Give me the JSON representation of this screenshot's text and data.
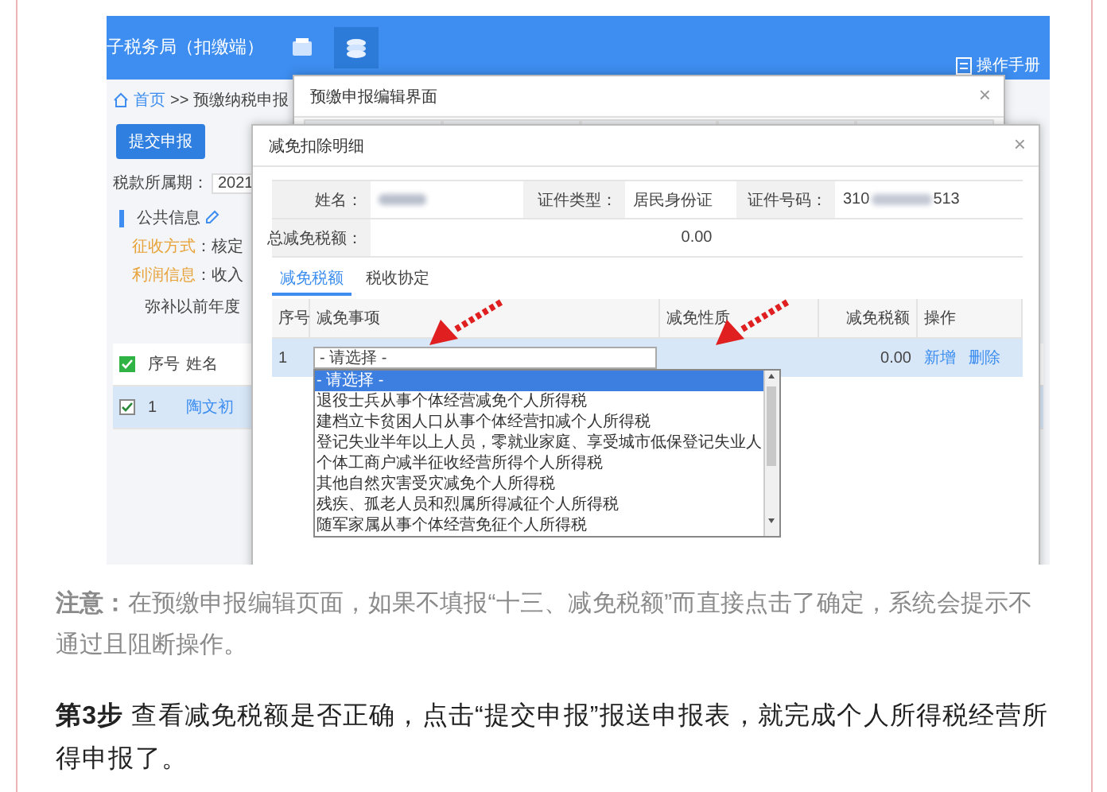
{
  "app": {
    "title": "子税务局（扣缴端）",
    "nav": [
      {
        "selected": false
      },
      {
        "selected": true
      }
    ],
    "manual_link": "操作手册",
    "breadcrumb": {
      "home": "首页",
      "separator": ">>",
      "current": "预缴纳税申报"
    },
    "submit_button": "提交申报",
    "period": {
      "label": "税款所属期：",
      "value": "2021"
    },
    "section_title": "公共信息",
    "fields": [
      {
        "label": "征收方式",
        "value": "：核定"
      },
      {
        "label": "利润信息",
        "value": "：收入"
      }
    ],
    "loss_note": "弥补以前年度",
    "table": {
      "header_checked": true,
      "columns": [
        "序号",
        "姓名"
      ],
      "rows": [
        {
          "checked": true,
          "selected": true,
          "index": "1",
          "name": "陶文初"
        }
      ]
    }
  },
  "edit_dialog": {
    "title": "预缴申报编辑界面",
    "close": "×"
  },
  "relief_dialog": {
    "title": "减免扣除明细",
    "close": "×",
    "form": {
      "name_label": "姓名：",
      "id_type_label": "证件类型：",
      "id_type": "居民身份证",
      "id_number_label": "证件号码：",
      "id_number_start": "310",
      "id_number_end": "513",
      "total_label": "总减免税额：",
      "total": "0.00"
    },
    "tabs": [
      {
        "label": "减免税额",
        "selected": true
      },
      {
        "label": "税收协定",
        "selected": false
      }
    ],
    "columns": [
      "序号",
      "减免事项",
      "减免性质",
      "减免税额",
      "操作"
    ],
    "rows": [
      {
        "index": "1",
        "select": "- 请选择 -",
        "amount": "0.00",
        "actions": [
          "新增",
          "删除"
        ]
      }
    ],
    "dropdown": [
      {
        "label": "- 请选择 -",
        "selected": true
      },
      {
        "label": "退役士兵从事个体经营减免个人所得税",
        "selected": false
      },
      {
        "label": "建档立卡贫困人口从事个体经营扣减个人所得税",
        "selected": false
      },
      {
        "label": "登记失业半年以上人员，零就业家庭、享受城市低保登记失业人",
        "selected": false
      },
      {
        "label": "个体工商户减半征收经营所得个人所得税",
        "selected": false
      },
      {
        "label": "其他自然灾害受灾减免个人所得税",
        "selected": false
      },
      {
        "label": "残疾、孤老人员和烈属所得减征个人所得税",
        "selected": false
      },
      {
        "label": "随军家属从事个体经营免征个人所得税",
        "selected": false
      }
    ]
  },
  "article": {
    "note": "**注意：**在预缴申报编辑页面，如果不填报“十三、减免税额”而直接点击了确定，系统会提示不通过且阻断操作。",
    "step": "**第3步** 查看减免税额是否正确，点击“提交申报”报送申报表，就完成个人所得税经营所得申报了。"
  }
}
